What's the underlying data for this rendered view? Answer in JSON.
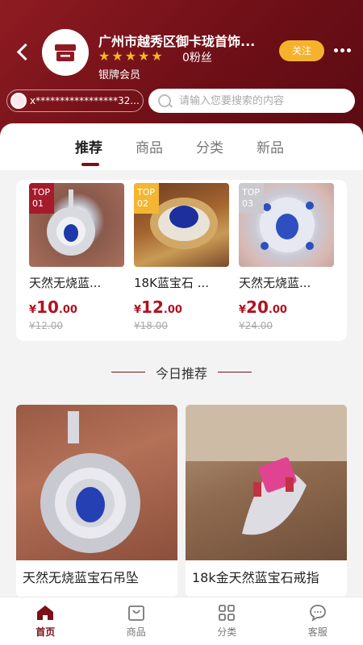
{
  "colors": {
    "brand": "#7a1019",
    "accent": "#f6b22c",
    "price": "#b01220"
  },
  "store": {
    "name": "广州市越秀区御卡珑首饰...",
    "fans": "0粉丝",
    "member_level": "银牌会员",
    "rating_stars": 5,
    "follow_label": "关注"
  },
  "account": {
    "masked_id": "x*****************32..."
  },
  "search": {
    "placeholder": "请输入您要搜索的内容"
  },
  "tabs": [
    {
      "label": "推荐",
      "active": true
    },
    {
      "label": "商品",
      "active": false
    },
    {
      "label": "分类",
      "active": false
    },
    {
      "label": "新品",
      "active": false
    }
  ],
  "top_products": [
    {
      "badge_top": "TOP",
      "badge_num": "01",
      "name": "天然无烧蓝...",
      "price_currency": "¥",
      "price_int": "10",
      "price_dec": ".00",
      "old_price": "¥12.00"
    },
    {
      "badge_top": "TOP",
      "badge_num": "02",
      "name": "18K蓝宝石 ...",
      "price_currency": "¥",
      "price_int": "12",
      "price_dec": ".00",
      "old_price": "¥18.00"
    },
    {
      "badge_top": "TOP",
      "badge_num": "03",
      "name": "天然无烧蓝...",
      "price_currency": "¥",
      "price_int": "20",
      "price_dec": ".00",
      "old_price": "¥24.00"
    }
  ],
  "today": {
    "title": "今日推荐"
  },
  "today_products": [
    {
      "name": "天然无烧蓝宝石吊坠"
    },
    {
      "name": "18k金天然蓝宝石戒指"
    }
  ],
  "nav": [
    {
      "label": "首页",
      "icon": "home-icon",
      "active": true
    },
    {
      "label": "商品",
      "icon": "bag-icon",
      "active": false
    },
    {
      "label": "分类",
      "icon": "grid-icon",
      "active": false
    },
    {
      "label": "客服",
      "icon": "chat-icon",
      "active": false
    }
  ]
}
